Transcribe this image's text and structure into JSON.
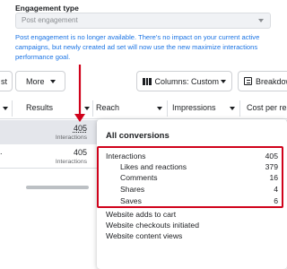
{
  "engagement": {
    "label": "Engagement type",
    "select_value": "Post engagement",
    "notice": "Post engagement is no longer available. There's no impact on your current active campaigns, but newly created ad set will now use the new maximize interactions performance goal."
  },
  "toolbar": {
    "partial_label": "st",
    "more_label": "More",
    "columns_label": "Columns: Custom",
    "breakdown_label": "Breakdow"
  },
  "table": {
    "headers": {
      "results": "Results",
      "reach": "Reach",
      "impressions": "Impressions",
      "cost": "Cost per res"
    },
    "rows": [
      {
        "results": "405",
        "results_sub": "Interactions"
      },
      {
        "results": "405",
        "results_sub": "Interactions"
      }
    ]
  },
  "popover": {
    "title": "All conversions",
    "items": [
      {
        "label": "Interactions",
        "value": "405"
      },
      {
        "label": "Likes and reactions",
        "value": "379"
      },
      {
        "label": "Comments",
        "value": "16"
      },
      {
        "label": "Shares",
        "value": "4"
      },
      {
        "label": "Saves",
        "value": "6"
      },
      {
        "label": "Website adds to cart",
        "value": ""
      },
      {
        "label": "Website checkouts initiated",
        "value": ""
      },
      {
        "label": "Website content views",
        "value": ""
      }
    ]
  },
  "colors": {
    "link": "#1b74e4",
    "annotation": "#d0021b",
    "row_highlight": "#e4e6eb"
  }
}
